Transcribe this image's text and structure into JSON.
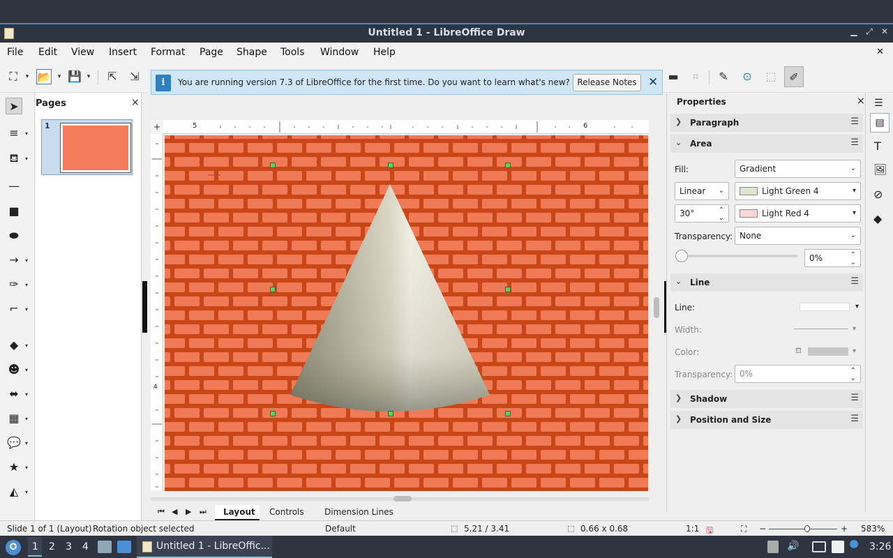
{
  "window": {
    "title": "Untitled 1 - LibreOffice Draw"
  },
  "menu": [
    "File",
    "Edit",
    "View",
    "Insert",
    "Format",
    "Page",
    "Shape",
    "Tools",
    "Window",
    "Help"
  ],
  "pages_panel": {
    "title": "Pages",
    "close": "×",
    "page_number": "1"
  },
  "infobar": {
    "icon": "i",
    "message": "You are running version 7.3 of LibreOffice for the first time. Do you want to learn what's new?",
    "button": "Release Notes",
    "close": "✕"
  },
  "ruler": {
    "h_labels": [
      "5",
      "6"
    ],
    "v_label": "4"
  },
  "tabs": [
    "Layout",
    "Controls",
    "Dimension Lines"
  ],
  "sidebar": {
    "title": "Properties",
    "close": "×",
    "sections": {
      "paragraph": "Paragraph",
      "area": "Area",
      "line": "Line",
      "shadow": "Shadow",
      "position": "Position and Size"
    },
    "area": {
      "fill_label": "Fill:",
      "fill_value": "Gradient",
      "gradient_type": "Linear",
      "color_from": "Light Green 4",
      "angle": "30°",
      "color_to": "Light Red 4",
      "transparency_label": "Transparency:",
      "transparency_value": "None",
      "transparency_percent": "0%",
      "color_from_hex": "#dde8cb",
      "color_to_hex": "#ffd7d7"
    },
    "line": {
      "line_label": "Line:",
      "width_label": "Width:",
      "color_label": "Color:",
      "transparency_label": "Transparency:",
      "transparency_value": "0%"
    }
  },
  "status": {
    "slide": "Slide 1 of 1 (Layout)",
    "selection": "Rotation object selected",
    "layout": "Default",
    "position": "5.21 / 3.41",
    "size": "0.66 x 0.68",
    "scale": "1:1",
    "zoom": "583%"
  },
  "taskbar": {
    "workspaces": [
      "1",
      "2",
      "3",
      "4"
    ],
    "active_window": "Untitled 1 - LibreOffic...",
    "clock": "3:26"
  },
  "colors": {
    "brick": "#f07a55",
    "mortar": "#c84618",
    "accent": "#5e81ac"
  }
}
